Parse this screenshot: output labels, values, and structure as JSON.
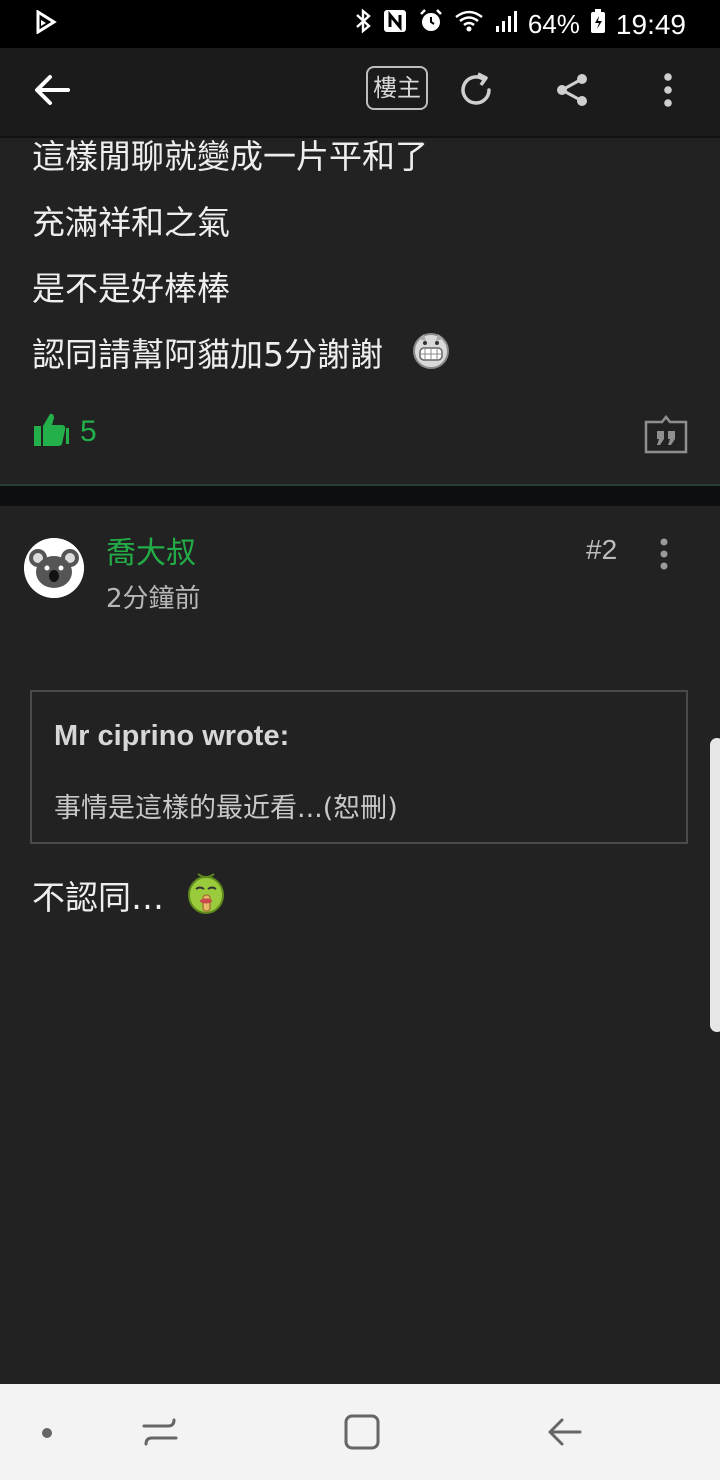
{
  "status_bar": {
    "battery_percent": "64%",
    "time": "19:49"
  },
  "app_bar": {
    "op_label": "樓主"
  },
  "post": {
    "lines": [
      "這樣閒聊就變成一片平和了",
      "充滿祥和之氣",
      "是不是好棒棒",
      "認同請幫阿貓加5分謝謝"
    ],
    "like_count": "5"
  },
  "reply": {
    "username": "喬大叔",
    "time_ago": "2分鐘前",
    "floor": "#2",
    "quote": {
      "author": "Mr ciprino wrote:",
      "excerpt": "事情是這樣的最近看...(恕刪)"
    },
    "text": "不認同…"
  },
  "colors": {
    "accent_green": "#22ad48",
    "background": "#222222"
  }
}
